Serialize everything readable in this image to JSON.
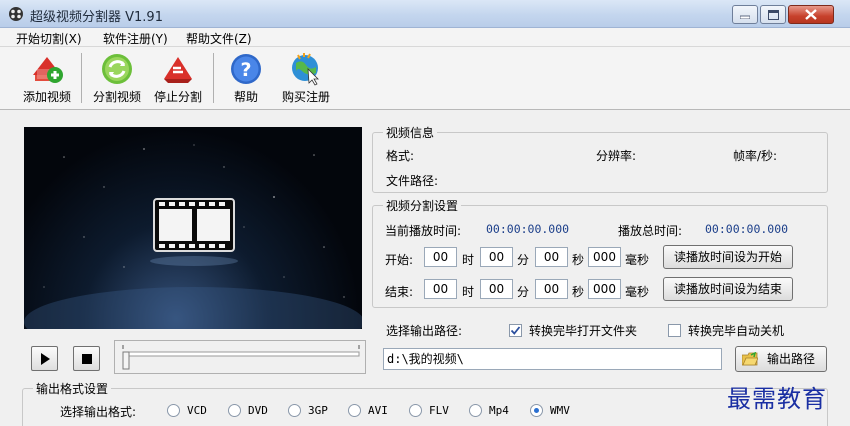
{
  "window": {
    "title": "超级视频分割器 V1.91"
  },
  "menu": [
    "开始切割(X)",
    "软件注册(Y)",
    "帮助文件(Z)"
  ],
  "toolbar": {
    "add": "添加视频",
    "split": "分割视频",
    "stop": "停止分割",
    "help": "帮助",
    "buy": "购买注册"
  },
  "video_info": {
    "title": "视频信息",
    "format_label": "格式:",
    "resolution_label": "分辨率:",
    "fps_label": "帧率/秒:",
    "path_label": "文件路径:"
  },
  "split_settings": {
    "title": "视频分割设置",
    "current_label": "当前播放时间:",
    "current_value": "00:00:00.000",
    "total_label": "播放总时间:",
    "total_value": "00:00:00.000",
    "start_label": "开始:",
    "end_label": "结束:",
    "hour_unit": "时",
    "min_unit": "分",
    "sec_unit": "秒",
    "ms_unit": "毫秒",
    "start_hour": "00",
    "start_min": "00",
    "start_sec": "00",
    "start_ms": "000",
    "end_hour": "00",
    "end_min": "00",
    "end_sec": "00",
    "end_ms": "000",
    "set_start_button": "读播放时间设为开始",
    "set_end_button": "读播放时间设为结束"
  },
  "output": {
    "path_label": "选择输出路径:",
    "open_folder_label": "转换完毕打开文件夹",
    "open_folder_checked": true,
    "shutdown_label": "转换完毕自动关机",
    "shutdown_checked": false,
    "path_value": "d:\\我的视频\\",
    "path_button": "输出路径"
  },
  "format_settings": {
    "title": "输出格式设置",
    "select_label": "选择输出格式:",
    "options": [
      "VCD",
      "DVD",
      "3GP",
      "AVI",
      "FLV",
      "Mp4",
      "WMV"
    ],
    "selected": "WMV"
  },
  "watermark": "最需教育"
}
